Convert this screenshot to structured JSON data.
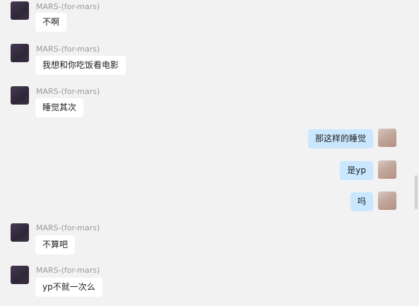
{
  "sender_name": "MARS-(for-mars)",
  "messages": [
    {
      "text": "不啊"
    },
    {
      "text": "我想和你吃饭看电影"
    },
    {
      "text": "睡觉其次"
    },
    {
      "text": "那这样的睡觉"
    },
    {
      "text": "是yp"
    },
    {
      "text": "吗"
    },
    {
      "text": "不算吧"
    },
    {
      "text": "yp不就一次么"
    }
  ],
  "colors": {
    "background": "#f2f2f2",
    "incoming_bubble": "#ffffff",
    "outgoing_bubble": "#c9e7ff",
    "name_text": "#9a9a9a"
  }
}
